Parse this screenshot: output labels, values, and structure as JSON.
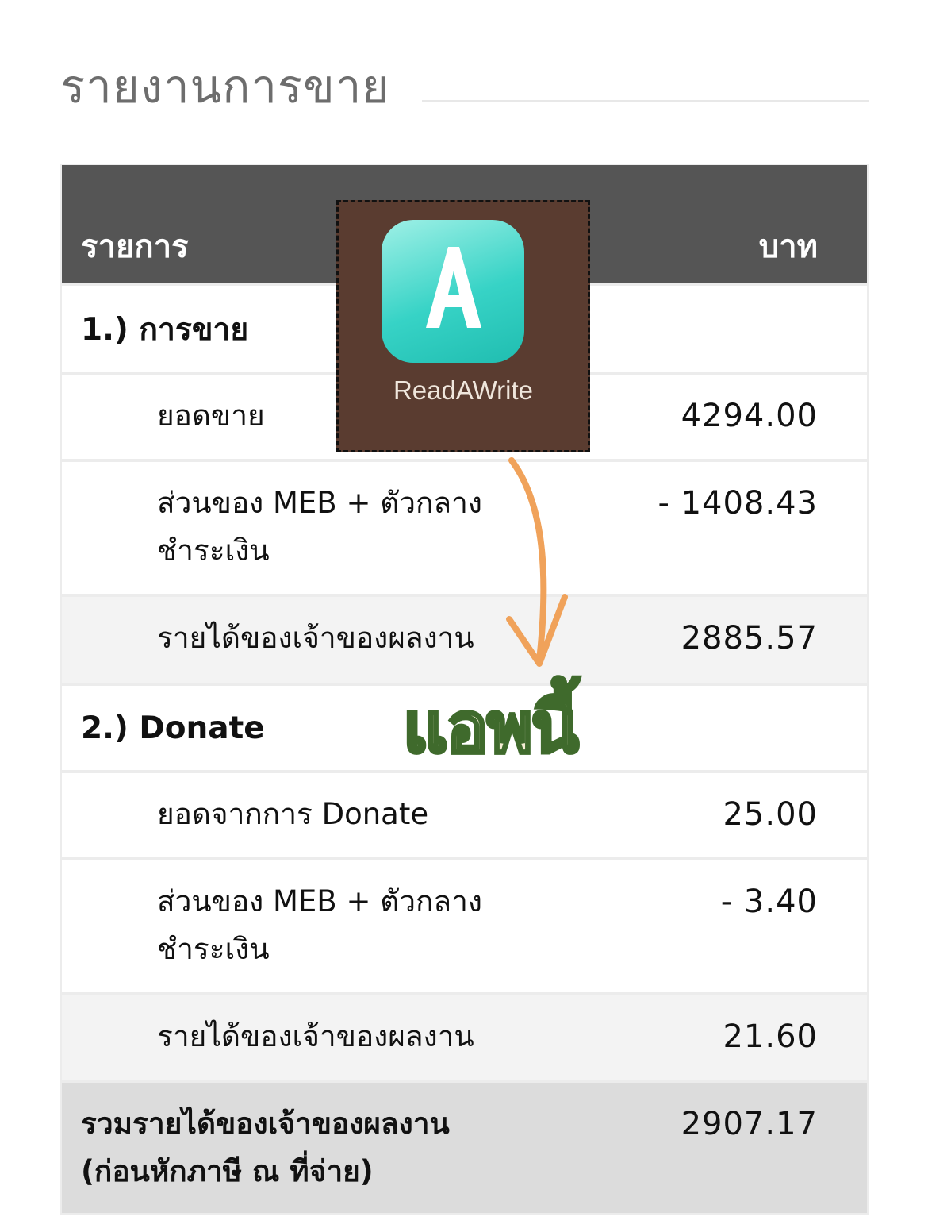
{
  "page": {
    "title": "รายงานการขาย"
  },
  "table": {
    "header": {
      "item": "รายการ",
      "unit": "บาท"
    },
    "section1": {
      "heading": "1.) การขาย",
      "sales_label": "ยอดขาย",
      "sales_value": "4294.00",
      "fee_label": "ส่วนของ MEB + ตัวกลางชำระเงิน",
      "fee_value": "- 1408.43",
      "income_label": "รายได้ของเจ้าของผลงาน",
      "income_value": "2885.57"
    },
    "section2": {
      "heading": "2.) Donate",
      "donate_label": "ยอดจากการ Donate",
      "donate_value": "25.00",
      "fee_label": "ส่วนของ MEB + ตัวกลางชำระเงิน",
      "fee_value": "- 3.40",
      "income_label": "รายได้ของเจ้าของผลงาน",
      "income_value": "21.60"
    },
    "total": {
      "label": "รวมรายได้ของเจ้าของผลงาน (ก่อนหักภาษี ณ ที่จ่าย)",
      "value": "2907.17"
    }
  },
  "overlay": {
    "app_name": "ReadAWrite",
    "icon": "readawrite-app-icon",
    "callout": "แอพนี้",
    "arrow": "arrow-down-icon",
    "colors": {
      "badge_bg": "#5a3c30",
      "icon_teal": "#37d3c6",
      "arrow": "#f0a25a",
      "callout_stroke": "#3f6a2c"
    }
  }
}
